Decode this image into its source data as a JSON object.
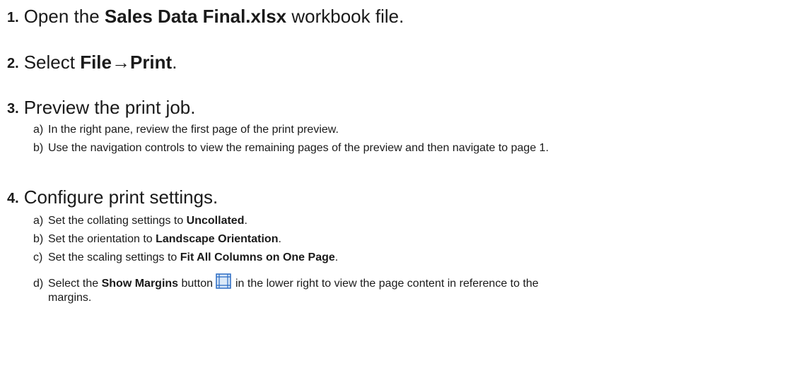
{
  "steps": [
    {
      "num": "1.",
      "text_before": "Open the ",
      "bold": "Sales Data Final.xlsx",
      "text_after": " workbook file."
    },
    {
      "num": "2.",
      "text_before": "Select ",
      "bold": "File→Print",
      "text_after": "."
    },
    {
      "num": "3.",
      "text": "Preview the print job.",
      "substeps": [
        {
          "letter": "a)",
          "text": "In the right pane, review the first page of the print preview."
        },
        {
          "letter": "b)",
          "text": "Use the navigation controls to view the remaining pages of the preview and then navigate to page 1."
        }
      ]
    },
    {
      "num": "4.",
      "text": "Configure print settings.",
      "substeps": [
        {
          "letter": "a)",
          "text_before": "Set the collating settings to ",
          "bold": "Uncollated",
          "text_after": "."
        },
        {
          "letter": "b)",
          "text_before": "Set the orientation to ",
          "bold": "Landscape Orientation",
          "text_after": "."
        },
        {
          "letter": "c)",
          "text_before": "Set the scaling settings to ",
          "bold": "Fit All Columns on One Page",
          "text_after": "."
        },
        {
          "letter": "d)",
          "text_before": "Select the ",
          "bold": "Show Margins",
          "text_mid": " button",
          "icon": "show-margins-icon",
          "text_after": "in the lower right to view the page content in reference to the",
          "text_cont": "margins."
        }
      ]
    }
  ],
  "colors": {
    "text": "#1a1a1a",
    "icon_blue": "#2b6cc4",
    "icon_fill": "#dbe9f8"
  }
}
